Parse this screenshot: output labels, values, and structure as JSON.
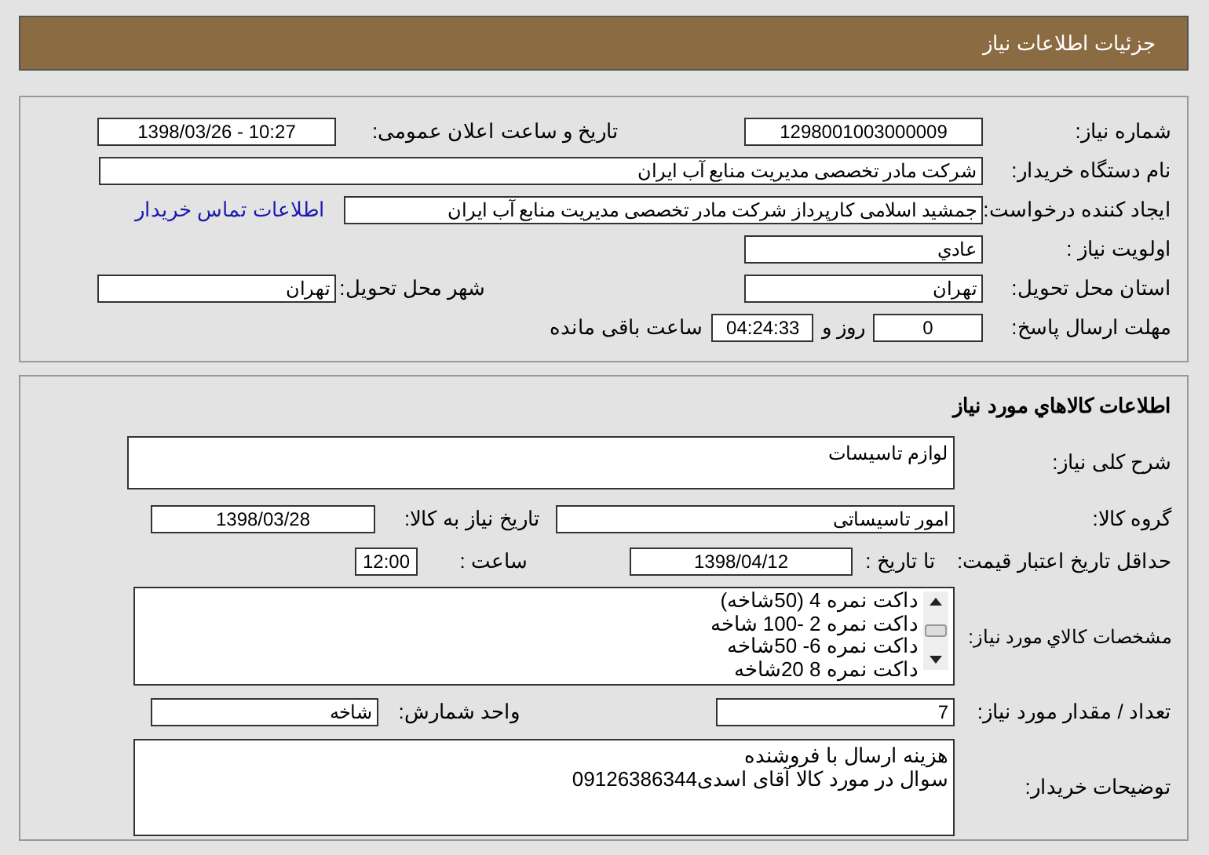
{
  "header": {
    "title": "جزئیات اطلاعات نیاز"
  },
  "general": {
    "need_number": {
      "label": "شماره نیاز:",
      "value": "1298001003000009"
    },
    "announce_datetime": {
      "label": "تاریخ و ساعت اعلان عمومی:",
      "value": "1398/03/26 - 10:27"
    },
    "buyer_org": {
      "label": "نام دستگاه خریدار:",
      "value": "شرکت مادر تخصصی مدیریت منابع آب ایران"
    },
    "requester": {
      "label": "ایجاد کننده درخواست:",
      "value": "جمشید  اسلامی کارپرداز شرکت مادر تخصصی مدیریت منابع آب ایران"
    },
    "buyer_contact_link": "اطلاعات تماس خریدار",
    "priority": {
      "label": "اولویت نیاز :",
      "value": "عادي"
    },
    "delivery_province": {
      "label": "استان محل تحویل:",
      "value": "تهران"
    },
    "delivery_city": {
      "label": "شهر محل تحویل:",
      "value": "تهران"
    },
    "deadline": {
      "label": "مهلت ارسال پاسخ:",
      "days": "0",
      "days_suffix": "روز و",
      "time": "04:24:33",
      "time_suffix": "ساعت باقی مانده"
    }
  },
  "goods": {
    "title": "اطلاعات كالاهاي مورد نياز",
    "summary": {
      "label": "شرح کلی نیاز:",
      "value": "لوازم تاسیسات"
    },
    "group": {
      "label": "گروه کالا:",
      "value": "امور تاسیساتی"
    },
    "need_date": {
      "label": "تاریخ نیاز به کالا:",
      "value": "1398/03/28"
    },
    "price_validity": {
      "label": "حداقل تاریخ اعتبار قیمت:",
      "date_label": "تا تاریخ :",
      "date": "1398/04/12",
      "time_label": "ساعت :",
      "time": "12:00"
    },
    "specs": {
      "label": "مشخصات كالاي مورد نياز:",
      "items": [
        "داکت نمره 4 (50شاخه)",
        "داکت نمره 2 -100 شاخه",
        "داکت نمره 6- 50شاخه",
        "داکت نمره 8 20شاخه"
      ]
    },
    "quantity": {
      "label": "تعداد / مقدار مورد نیاز:",
      "value": "7"
    },
    "unit": {
      "label": "واحد شمارش:",
      "value": "شاخه"
    },
    "buyer_notes": {
      "label": "توضیحات خریدار:",
      "lines": [
        "هزینه ارسال با فروشنده",
        "سوال در مورد کالا آقای اسدی09126386344"
      ]
    }
  }
}
